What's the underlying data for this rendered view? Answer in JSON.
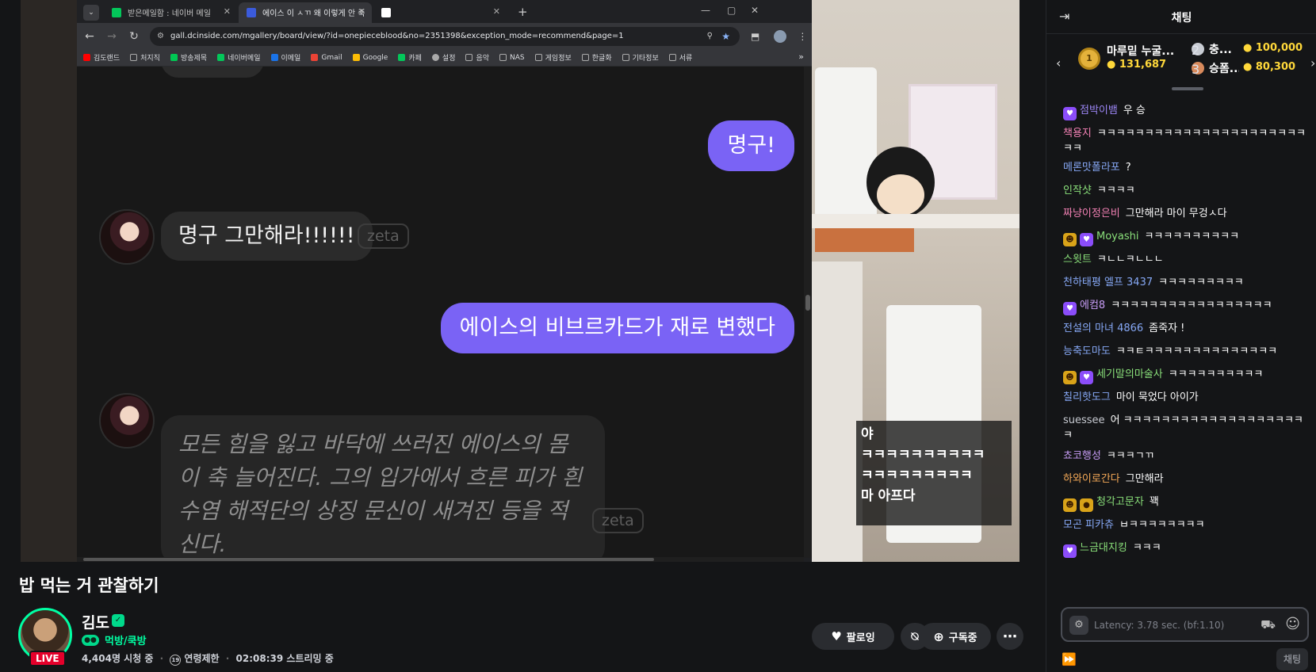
{
  "browser": {
    "tabs": [
      {
        "label": "받은메일함 : 네이버 메일",
        "fav_color": "#03c75a"
      },
      {
        "label": "에이스 이 ㅅㄲ 왜 이렇게 안 죽",
        "fav_color": "#3b5bdb"
      },
      {
        "label": "",
        "fav_color": "#ffffff"
      }
    ],
    "url": "gall.dcinside.com/mgallery/board/view/?id=onepieceblood&no=2351398&exception_mode=recommend&page=1",
    "bookmarks": [
      {
        "label": "김도랜드",
        "color": "#ff0000"
      },
      {
        "label": "처지직",
        "color": "#888888"
      },
      {
        "label": "방송제목",
        "color": "#00c853"
      },
      {
        "label": "네이버메일",
        "color": "#03c75a"
      },
      {
        "label": "이메일",
        "color": "#1a73e8"
      },
      {
        "label": "Gmail",
        "color": "#ea4335"
      },
      {
        "label": "Google",
        "color": "#fbbc05"
      },
      {
        "label": "카페",
        "color": "#03c75a"
      },
      {
        "label": "설정",
        "color": "#aaaaaa"
      },
      {
        "label": "음악",
        "color": "#aaaaaa"
      },
      {
        "label": "NAS",
        "color": "#aaaaaa"
      },
      {
        "label": "게임정보",
        "color": "#aaaaaa"
      },
      {
        "label": "한글화",
        "color": "#aaaaaa"
      },
      {
        "label": "기타정보",
        "color": "#aaaaaa"
      },
      {
        "label": "서류",
        "color": "#aaaaaa"
      }
    ],
    "more": "»"
  },
  "conversation": {
    "me1": "명구!",
    "ai1": "명구 그만해라!!!!!!",
    "zeta": "zeta",
    "me2": "에이스의 비브르카드가 재로 변했다",
    "narration": "모든 힘을 잃고 바닥에 쓰러진 에이스의 몸이 축 늘어진다. 그의 입가에서 흐른 피가 흰 수염 해적단의 상징 문신이 새겨진 등을 적신다."
  },
  "overlay_caption": [
    "야",
    "ㅋㅋㅋㅋㅋㅋㅋㅋㅋㅋ",
    "ㅋㅋㅋㅋㅋㅋㅋㅋㅋ",
    "마 아프다"
  ],
  "stream": {
    "title": "밥 먹는 거 관찰하기",
    "channel": "김도",
    "category": "먹방/쿡방",
    "live_label": "LIVE",
    "viewers": "4,404명 시청 중",
    "age": "연령제한",
    "age_icon": "19",
    "uptime": "02:08:39 스트리밍 중",
    "follow_label": "팔로잉",
    "subscribe_label": "구독중",
    "accent": "#00ffa3"
  },
  "chat": {
    "header": "채팅",
    "ranking": [
      {
        "name": "마루밑 누굴...",
        "amount": "131,687",
        "medal": "1"
      },
      {
        "name": "충...",
        "amount": "100,000",
        "medal": "2"
      },
      {
        "name": "승폼...",
        "amount": "80,300",
        "medal": "3"
      }
    ],
    "messages": [
      {
        "nick": "점박이뱀",
        "text": "우 승",
        "color": "#9c86f5",
        "badges": [
          "heart"
        ]
      },
      {
        "nick": "책용지",
        "text": "ㅋㅋㅋㅋㅋㅋㅋㅋㅋㅋㅋㅋㅋㅋㅋㅋㅋㅋㅋㅋㅋㅋㅋㅋ",
        "color": "#f281b4",
        "badges": []
      },
      {
        "nick": "메론맛폴라포",
        "text": "?",
        "color": "#86a8f5",
        "badges": []
      },
      {
        "nick": "인작샷",
        "text": "ㅋㅋㅋㅋ",
        "color": "#8ae07a",
        "badges": []
      },
      {
        "nick": "짜냥이정은비",
        "text": "그만해라 마이 무겅ㅅ다",
        "color": "#f281b4",
        "badges": []
      },
      {
        "nick": "Moyashi",
        "text": "ㅋㅋㅋㅋㅋㅋㅋㅋㅋㅋ",
        "color": "#8ae07a",
        "badges": [
          "emoji",
          "heart"
        ]
      },
      {
        "nick": "스윗트",
        "text": "ㅋㄴㄴㅋㄴㄴㄴ",
        "color": "#8ae07a",
        "badges": []
      },
      {
        "nick": "천하태평 엘프 3437",
        "text": "ㅋㅋㅋㅋㅋㅋㅋㅋㅋ",
        "color": "#86a8f5",
        "badges": []
      },
      {
        "nick": "에컴8",
        "text": "ㅋㅋㅋㅋㅋㅋㅋㅋㅋㅋㅋㅋㅋㅋㅋㅋㅋ",
        "color": "#c79cf5",
        "badges": [
          "heart"
        ]
      },
      {
        "nick": "전설의 마녀 4866",
        "text": "좀죽자 !",
        "color": "#86a8f5",
        "badges": []
      },
      {
        "nick": "능축도마도",
        "text": "ㅋㅋㅌㅋㅋㅋㅋㅋㅋㅋㅋㅋㅋㅋㅋㅋㅋ",
        "color": "#86a8f5",
        "badges": []
      },
      {
        "nick": "세기말의마술사",
        "text": "ㅋㅋㅋㅋㅋㅋㅋㅋㅋㅋ",
        "color": "#8ae07a",
        "badges": [
          "emoji",
          "heart"
        ]
      },
      {
        "nick": "칠리핫도그",
        "text": "마이 묵었다 아이가",
        "color": "#86a8f5",
        "badges": []
      },
      {
        "nick": "suessee",
        "text": "어 ㅋㅋㅋㅋㅋㅋㅋㅋㅋㅋㅋㅋㅋㅋㅋㅋㅋㅋㅋㅋ",
        "color": "#c8cbd2",
        "badges": []
      },
      {
        "nick": "쵸코행성",
        "text": "ㅋㅋㅋㄱㄲ",
        "color": "#c79cf5",
        "badges": []
      },
      {
        "nick": "하와이로간다",
        "text": "그만해라",
        "color": "#f5a957",
        "badges": []
      },
      {
        "nick": "청각고문자",
        "text": "꽥",
        "color": "#8ae07a",
        "badges": [
          "emoji",
          "coin"
        ]
      },
      {
        "nick": "모곤 피카츄",
        "text": "ㅂㅋㅋㅋㅋㅋㅋㅋㅋ",
        "color": "#86a8f5",
        "badges": []
      },
      {
        "nick": "느금대지킹",
        "text": "ㅋㅋㅋ",
        "color": "#8ae07a",
        "badges": [
          "heart"
        ]
      }
    ],
    "input_placeholder": "Latency: 3.78 sec. (bf:1.10)",
    "send_label": "채팅"
  }
}
